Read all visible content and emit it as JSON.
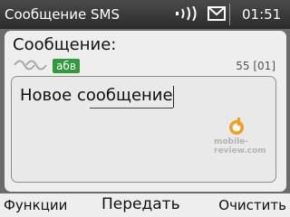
{
  "statusbar": {
    "title": "Сообщение SMS",
    "clock": "01:51",
    "signal_icon": "signal-icon",
    "message_icon": "envelope-icon"
  },
  "editor": {
    "heading": "Сообщение:",
    "input_mode_icon": "predictive-text-icon",
    "input_mode_label": "абв",
    "char_counter": "55 [01]",
    "message_text": "Новое сообщение",
    "watermark": "mobile-review.com",
    "logo_icon": "mobile-review-logo"
  },
  "softkeys": {
    "left": "Функции",
    "middle": "Передать",
    "right": "Очистить"
  },
  "colors": {
    "status_bg": "#2b2b2b",
    "panel_bg": "#eeeeee",
    "frame_bg": "#6b6b6b",
    "input_mode_badge": "#2f9b3a"
  }
}
